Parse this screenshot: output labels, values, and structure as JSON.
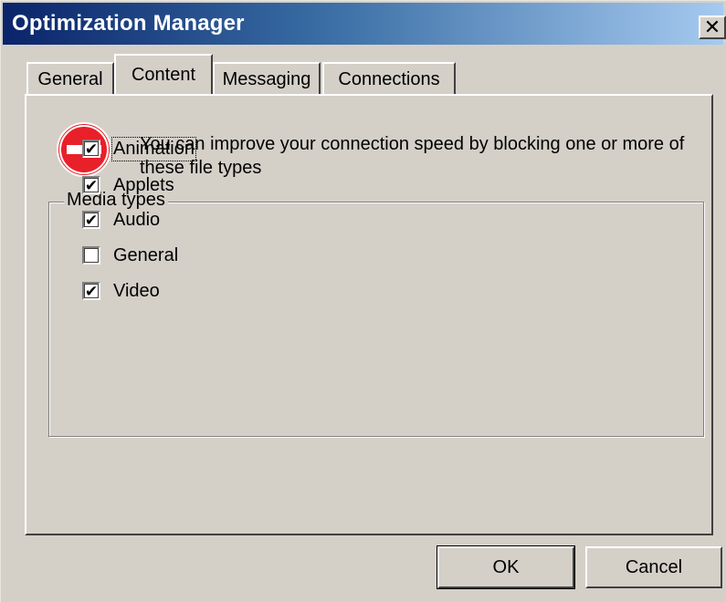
{
  "window": {
    "title": "Optimization Manager",
    "close_glyph": "✕"
  },
  "tabs": [
    {
      "label": "General",
      "active": false
    },
    {
      "label": "Content",
      "active": true
    },
    {
      "label": "Messaging",
      "active": false
    },
    {
      "label": "Connections",
      "active": false
    }
  ],
  "content": {
    "icon": "stop-icon",
    "info_text": "You can improve your connection speed by blocking one or more of these file types",
    "media_group": {
      "label": "Media types",
      "items": [
        {
          "label": "Animation",
          "checked": true,
          "focused": true
        },
        {
          "label": "Applets",
          "checked": true,
          "focused": false
        },
        {
          "label": "Audio",
          "checked": true,
          "focused": false
        },
        {
          "label": "General",
          "checked": false,
          "focused": false
        },
        {
          "label": "Video",
          "checked": true,
          "focused": false
        }
      ]
    }
  },
  "buttons": {
    "ok_label": "OK",
    "cancel_label": "Cancel"
  },
  "colors": {
    "title_start": "#0a246a",
    "title_end": "#a6caf0",
    "face": "#d4d0c8",
    "stop_red": "#e8202a"
  }
}
